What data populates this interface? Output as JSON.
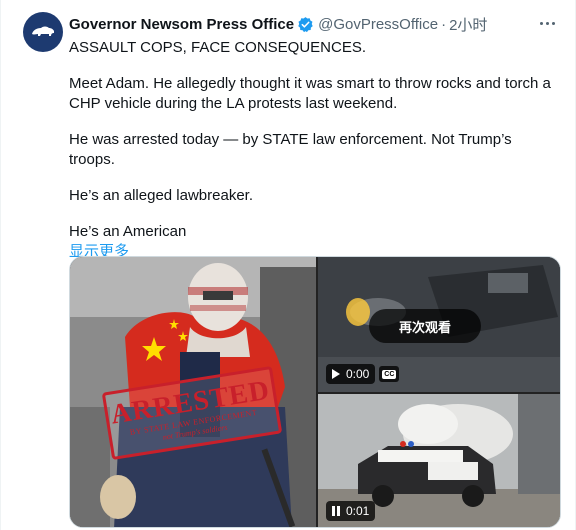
{
  "tweet": {
    "display_name": "Governor Newsom Press Office",
    "handle": "@GovPressOffice",
    "separator": "·",
    "time": "2小时",
    "paragraphs": [
      "ASSAULT COPS, FACE CONSEQUENCES.",
      "Meet Adam. He allegedly thought it was smart to throw rocks and torch a CHP vehicle during the LA protests last weekend.",
      "He was arrested today — by STATE law enforcement. Not Trump’s troops.",
      "He’s an alleged lawbreaker.",
      "He’s an American"
    ],
    "show_more": "显示更多"
  },
  "media": {
    "stamp": {
      "title": "ARRESTED",
      "line1": "BY STATE LAW ENFORCEMENT",
      "line2": "not Trump's soldiers"
    },
    "video1": {
      "replay_label": "再次观看",
      "time": "0:00",
      "cc_label": "CC"
    },
    "video2": {
      "time": "0:01"
    }
  },
  "colors": {
    "accent": "#1d9bf0",
    "verified": "#1d9bf0",
    "stamp_red": "#c8202b",
    "flag_red": "#d52b1e",
    "flag_star": "#ffde00"
  },
  "icons": {
    "avatar": "california-bear-icon",
    "verified": "verified-badge-icon",
    "more": "more-dots-icon",
    "play": "play-icon",
    "pause": "pause-icon",
    "captions": "closed-captions-icon"
  }
}
